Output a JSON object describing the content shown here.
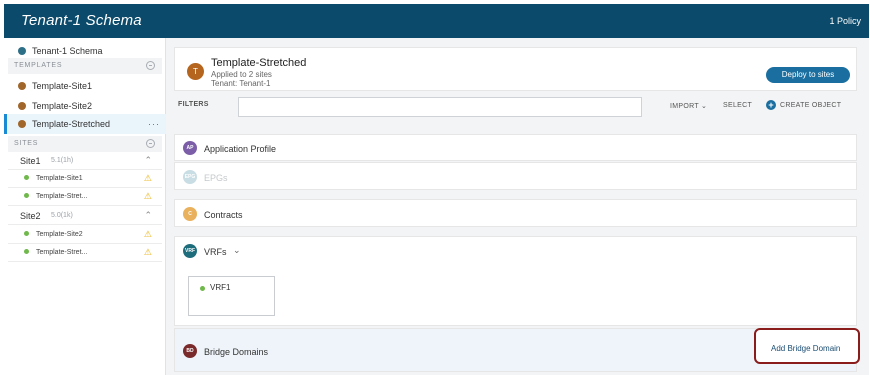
{
  "header": {
    "title": "Tenant-1 Schema",
    "policy": "1 Policy"
  },
  "sidebar": {
    "schema_label": "Tenant-1 Schema",
    "templates_header": "TEMPLATES",
    "templates": [
      "Template-Site1",
      "Template-Site2",
      "Template-Stretched"
    ],
    "more": "···",
    "sites_header": "SITES",
    "sites": [
      {
        "name": "Site1",
        "version": "5.1(1h)",
        "templates": [
          "Template-Site1",
          "Template-Stret..."
        ]
      },
      {
        "name": "Site2",
        "version": "5.0(1k)",
        "templates": [
          "Template-Site2",
          "Template-Stret..."
        ]
      }
    ]
  },
  "template": {
    "avatar": "T",
    "name": "Template-Stretched",
    "applied": "Applied to 2 sites",
    "tenant": "Tenant: Tenant-1",
    "deploy_label": "Deploy to sites"
  },
  "filter": {
    "label": "FILTERS",
    "placeholder": "",
    "import_label": "IMPORT ⌄",
    "select_label": "SELECT",
    "create_label": "CREATE OBJECT"
  },
  "sections": {
    "app_profile": {
      "badge": "AP",
      "label": "Application Profile"
    },
    "epgs": {
      "badge": "EPG",
      "label": "EPGs"
    },
    "contracts": {
      "badge": "C",
      "label": "Contracts"
    },
    "vrfs": {
      "badge": "VRF",
      "label": "VRFs"
    },
    "vrf_item": "VRF1",
    "bridge_domains": {
      "badge": "BD",
      "label": "Bridge Domains"
    }
  },
  "add_bridge_domain": "Add Bridge Domain",
  "colors": {
    "header_bg": "#0b4a6b",
    "accent": "#1a6fa0",
    "warning": "#e8b114",
    "highlight_border": "#8b1c1c"
  },
  "icons": {
    "warning": "⚠",
    "chevron_up": "⌃",
    "chevron_down": "⌄"
  }
}
